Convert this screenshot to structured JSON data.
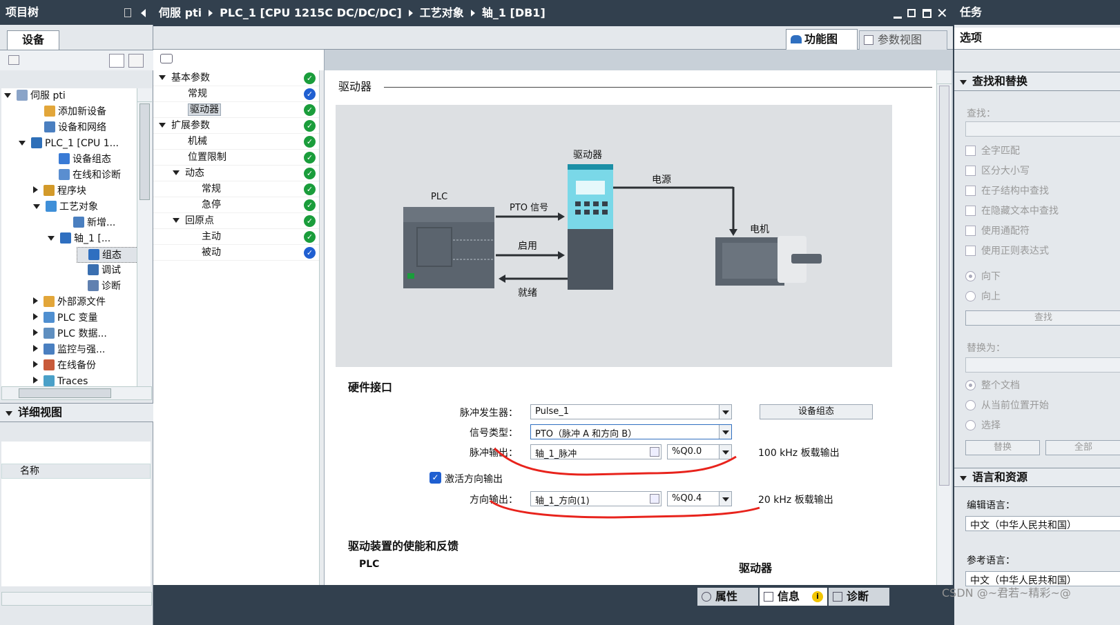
{
  "left_panel": {
    "title": "项目树",
    "tab": "设备",
    "tree": [
      {
        "label": "伺服 pti",
        "expand": "down",
        "indent": 0,
        "icon": "project-icon"
      },
      {
        "label": "添加新设备",
        "expand": "",
        "indent": 2,
        "icon": "add-device-icon"
      },
      {
        "label": "设备和网络",
        "expand": "",
        "indent": 2,
        "icon": "network-icon"
      },
      {
        "label": "PLC_1 [CPU 1...",
        "expand": "down",
        "indent": 1,
        "icon": "plc-icon"
      },
      {
        "label": "设备组态",
        "expand": "",
        "indent": 3,
        "icon": "device-config-icon"
      },
      {
        "label": "在线和诊断",
        "expand": "",
        "indent": 3,
        "icon": "online-diag-icon"
      },
      {
        "label": "程序块",
        "expand": "right",
        "indent": 2,
        "icon": "program-blocks-icon"
      },
      {
        "label": "工艺对象",
        "expand": "down",
        "indent": 2,
        "icon": "tech-objects-icon"
      },
      {
        "label": "新增...",
        "expand": "",
        "indent": 4,
        "icon": "add-object-icon"
      },
      {
        "label": "轴_1 [...",
        "expand": "down",
        "indent": 3,
        "icon": "axis-icon"
      },
      {
        "label": "组态",
        "expand": "",
        "indent": 5,
        "icon": "config-icon",
        "selected": true
      },
      {
        "label": "调试",
        "expand": "",
        "indent": 5,
        "icon": "commissioning-icon"
      },
      {
        "label": "诊断",
        "expand": "",
        "indent": 5,
        "icon": "diagnostics-icon"
      },
      {
        "label": "外部源文件",
        "expand": "right",
        "indent": 2,
        "icon": "external-source-icon"
      },
      {
        "label": "PLC 变量",
        "expand": "right",
        "indent": 2,
        "icon": "plc-tags-icon"
      },
      {
        "label": "PLC 数据...",
        "expand": "right",
        "indent": 2,
        "icon": "plc-data-icon"
      },
      {
        "label": "监控与强...",
        "expand": "right",
        "indent": 2,
        "icon": "watch-force-icon"
      },
      {
        "label": "在线备份",
        "expand": "right",
        "indent": 2,
        "icon": "online-backup-icon"
      },
      {
        "label": "Traces",
        "expand": "right",
        "indent": 2,
        "icon": "traces-icon"
      }
    ],
    "detail_view": {
      "title": "详细视图",
      "column": "名称"
    }
  },
  "header": {
    "breadcrumb": [
      "伺服 pti",
      "PLC_1 [CPU 1215C DC/DC/DC]",
      "工艺对象",
      "轴_1 [DB1]"
    ],
    "tab_function": "功能图",
    "tab_params": "参数视图"
  },
  "nav_tree": [
    {
      "label": "基本参数",
      "expand": "down",
      "indent": 0,
      "status": "green"
    },
    {
      "label": "常规",
      "expand": "",
      "indent": 1,
      "status": "blue"
    },
    {
      "label": "驱动器",
      "expand": "",
      "indent": 1,
      "status": "green",
      "selected": true
    },
    {
      "label": "扩展参数",
      "expand": "down",
      "indent": 0,
      "status": "green"
    },
    {
      "label": "机械",
      "expand": "",
      "indent": 1,
      "status": "green"
    },
    {
      "label": "位置限制",
      "expand": "",
      "indent": 1,
      "status": "green"
    },
    {
      "label": "动态",
      "expand": "down",
      "indent": 1,
      "status": "green"
    },
    {
      "label": "常规",
      "expand": "",
      "indent": 2,
      "status": "green"
    },
    {
      "label": "急停",
      "expand": "",
      "indent": 2,
      "status": "green"
    },
    {
      "label": "回原点",
      "expand": "down",
      "indent": 1,
      "status": "green"
    },
    {
      "label": "主动",
      "expand": "",
      "indent": 2,
      "status": "green"
    },
    {
      "label": "被动",
      "expand": "",
      "indent": 2,
      "status": "blue"
    }
  ],
  "content": {
    "section_title": "驱动器",
    "diagram": {
      "plc": "PLC",
      "drive": "驱动器",
      "motor": "电机",
      "power": "电源",
      "pto_signal": "PTO 信号",
      "enable": "启用",
      "ready": "就绪"
    },
    "hw_title": "硬件接口",
    "pulse_gen_label": "脉冲发生器：",
    "pulse_gen_value": "Pulse_1",
    "device_config_btn": "设备组态",
    "signal_type_label": "信号类型：",
    "signal_type_value": "PTO（脉冲 A 和方向 B）",
    "pulse_out_label": "脉冲输出：",
    "pulse_out_value": "轴_1_脉冲",
    "pulse_out_addr": "%Q0.0",
    "pulse_out_note": "100 kHz 板载输出",
    "activate_dir_label": "激活方向输出",
    "dir_out_label": "方向输出：",
    "dir_out_value": "轴_1_方向(1)",
    "dir_out_addr": "%Q0.4",
    "dir_out_note": "20 kHz 板载输出",
    "enable_title": "驱动装置的使能和反馈",
    "enable_plc": "PLC",
    "enable_drive": "驱动器"
  },
  "bottom_tabs": {
    "properties": "属性",
    "info": "信息",
    "diagnostics": "诊断"
  },
  "right_panel": {
    "title": "任务",
    "options": "选项",
    "find_replace": "查找和替换",
    "find_label": "查找：",
    "checkboxes": [
      "全字匹配",
      "区分大小写",
      "在子结构中查找",
      "在隐藏文本中查找",
      "使用通配符",
      "使用正则表达式"
    ],
    "directions": [
      "向下",
      "向上"
    ],
    "find_btn": "查找",
    "replace_label": "替换为：",
    "scopes": [
      "整个文档",
      "从当前位置开始",
      "选择"
    ],
    "replace_btn": "替换",
    "replace_all_btn": "全部",
    "lang_title": "语言和资源",
    "edit_lang_label": "编辑语言：",
    "edit_lang_value": "中文（中华人民共和国）",
    "ref_lang_label": "参考语言：",
    "ref_lang_value": "中文（中华人民共和国）"
  },
  "watermark": "CSDN @~君若~精彩~@"
}
